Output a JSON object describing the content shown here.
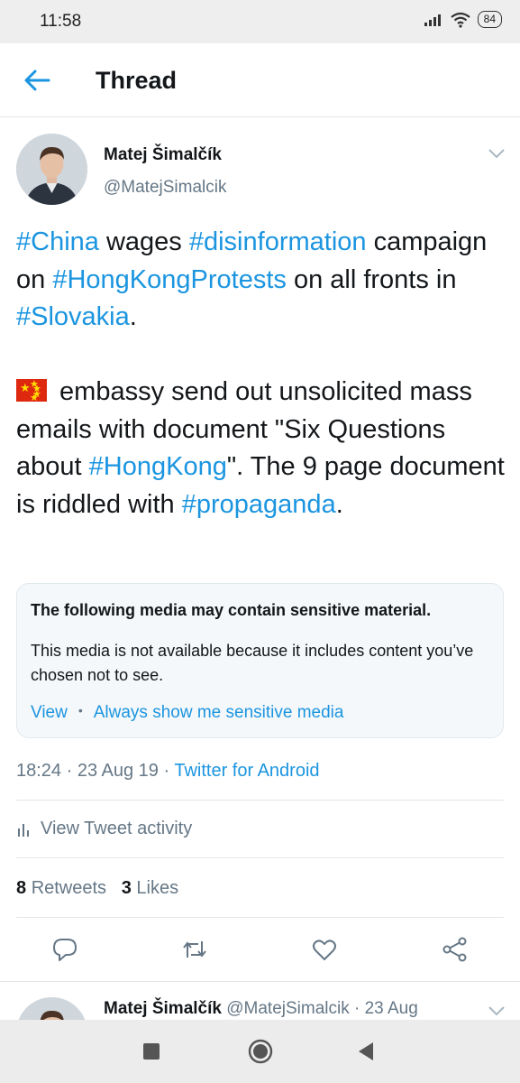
{
  "status_bar": {
    "time": "11:58",
    "battery": "84"
  },
  "header": {
    "title": "Thread"
  },
  "tweet": {
    "author_name": "Matej Šimalčík",
    "author_handle": "@MatejSimalcik",
    "text": {
      "p1_tag1": "#China",
      "p1_t1": " wages ",
      "p1_tag2": "#disinformation",
      "p1_t2": " campaign on ",
      "p1_tag3": "#HongKongProtests",
      "p1_t3": " on all fronts in ",
      "p1_tag4": "#Slovakia",
      "p1_t4": ".",
      "p2_t1": " embassy send out unsolicited mass emails with document \"Six Questions about ",
      "p2_tag1": "#HongKong",
      "p2_t2": "\". The 9 page document is riddled with ",
      "p2_tag2": "#propaganda",
      "p2_t3": "."
    },
    "sensitive": {
      "title": "The following media may contain sensitive material.",
      "body": "This media is not available because it includes content you’ve chosen not to see.",
      "view_label": "View",
      "separator": "•",
      "always_show_label": "Always show me sensitive media"
    },
    "meta": {
      "time_date": "18:24 · 23 Aug 19 · ",
      "source": "Twitter for Android"
    },
    "activity_label": "View Tweet activity",
    "stats": {
      "retweets_count": "8",
      "retweets_label": "Retweets",
      "likes_count": "3",
      "likes_label": "Likes"
    }
  },
  "reply": {
    "author_name": "Matej Šimalčík",
    "author_handle": "@MatejSimalcik",
    "date": "· 23 Aug"
  },
  "colors": {
    "link": "#1b95e0",
    "secondary": "#657786",
    "text": "#14171a",
    "flag_red": "#de2910",
    "flag_yellow": "#ffde00"
  },
  "icons": [
    "signal-icon",
    "wifi-icon",
    "battery-icon",
    "back-arrow-icon",
    "chevron-down-icon",
    "bar-chart-icon",
    "reply-icon",
    "retweet-icon",
    "like-icon",
    "share-icon",
    "nav-recents-icon",
    "nav-home-icon",
    "nav-back-icon",
    "china-flag-emoji"
  ]
}
